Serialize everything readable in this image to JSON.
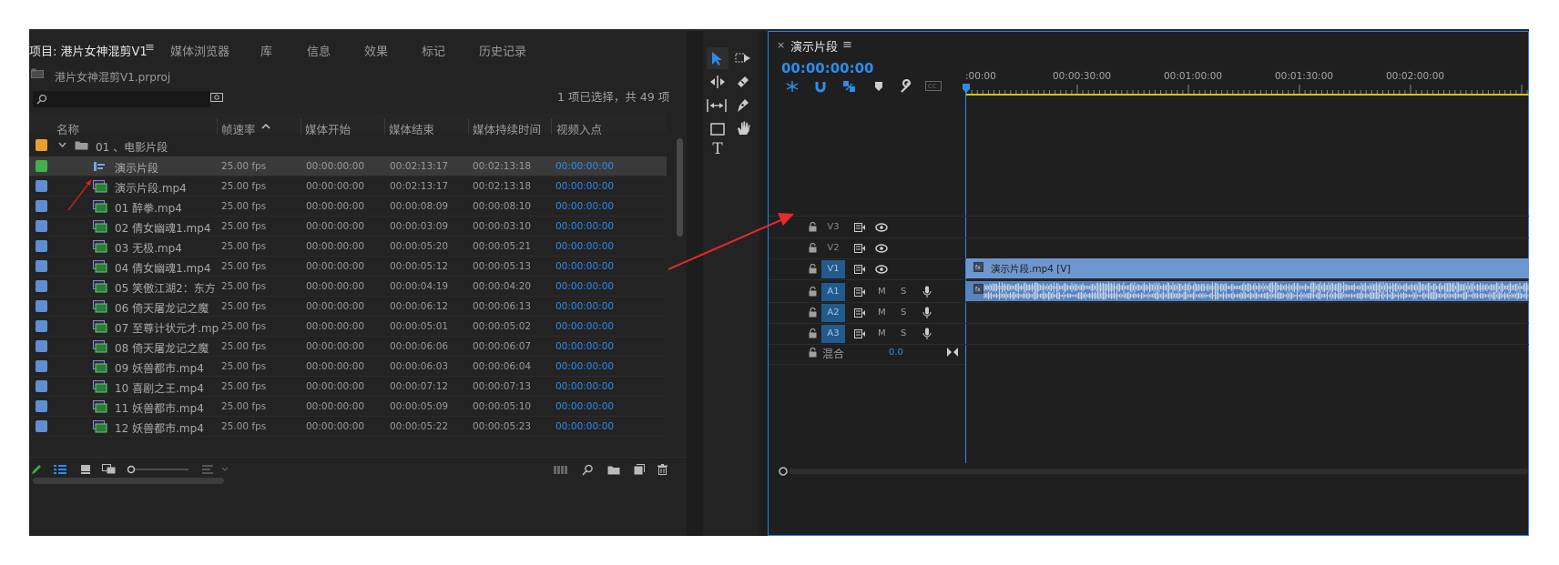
{
  "project": {
    "tabs": [
      {
        "label": "项目: 港片女神混剪V1",
        "active": true
      },
      {
        "label": "媒体浏览器"
      },
      {
        "label": "库"
      },
      {
        "label": "信息"
      },
      {
        "label": "效果"
      },
      {
        "label": "标记"
      },
      {
        "label": "历史记录"
      }
    ],
    "file": "港片女神混剪V1.prproj",
    "selection_info": "1 项已选择，共 49 项",
    "columns": [
      "名称",
      "帧速率",
      "媒体开始",
      "媒体结束",
      "媒体持续时间",
      "视频入点"
    ],
    "folder": {
      "label": "01 、电影片段",
      "color": "#e8a030"
    },
    "rows": [
      {
        "name": "演示片段",
        "fps": "25.00 fps",
        "start": "00:00:00:00",
        "end": "00:02:13:17",
        "dur": "00:02:13:18",
        "in": "00:00:00:00",
        "color": "#44b04a",
        "type": "sequence",
        "selected": true
      },
      {
        "name": "演示片段.mp4",
        "fps": "25.00 fps",
        "start": "00:00:00:00",
        "end": "00:02:13:17",
        "dur": "00:02:13:18",
        "in": "00:00:00:00",
        "color": "#5f8fd0",
        "type": "clip"
      },
      {
        "name": "01 醉拳.mp4",
        "fps": "25.00 fps",
        "start": "00:00:00:00",
        "end": "00:00:08:09",
        "dur": "00:00:08:10",
        "in": "00:00:00:00",
        "color": "#5f8fd0",
        "type": "clip"
      },
      {
        "name": "02 倩女幽魂1.mp4",
        "fps": "25.00 fps",
        "start": "00:00:00:00",
        "end": "00:00:03:09",
        "dur": "00:00:03:10",
        "in": "00:00:00:00",
        "color": "#5f8fd0",
        "type": "clip"
      },
      {
        "name": "03 无极.mp4",
        "fps": "25.00 fps",
        "start": "00:00:00:00",
        "end": "00:00:05:20",
        "dur": "00:00:05:21",
        "in": "00:00:00:00",
        "color": "#5f8fd0",
        "type": "clip"
      },
      {
        "name": "04 倩女幽魂1.mp4",
        "fps": "25.00 fps",
        "start": "00:00:00:00",
        "end": "00:00:05:12",
        "dur": "00:00:05:13",
        "in": "00:00:00:00",
        "color": "#5f8fd0",
        "type": "clip"
      },
      {
        "name": "05 笑傲江湖2：东方",
        "fps": "25.00 fps",
        "start": "00:00:00:00",
        "end": "00:00:04:19",
        "dur": "00:00:04:20",
        "in": "00:00:00:00",
        "color": "#5f8fd0",
        "type": "clip"
      },
      {
        "name": "06 倚天屠龙记之魔",
        "fps": "25.00 fps",
        "start": "00:00:00:00",
        "end": "00:00:06:12",
        "dur": "00:00:06:13",
        "in": "00:00:00:00",
        "color": "#5f8fd0",
        "type": "clip"
      },
      {
        "name": "07 至尊计状元才.mp",
        "fps": "25.00 fps",
        "start": "00:00:00:00",
        "end": "00:00:05:01",
        "dur": "00:00:05:02",
        "in": "00:00:00:00",
        "color": "#5f8fd0",
        "type": "clip"
      },
      {
        "name": "08 倚天屠龙记之魔",
        "fps": "25.00 fps",
        "start": "00:00:00:00",
        "end": "00:00:06:06",
        "dur": "00:00:06:07",
        "in": "00:00:00:00",
        "color": "#5f8fd0",
        "type": "clip"
      },
      {
        "name": "09 妖兽都市.mp4",
        "fps": "25.00 fps",
        "start": "00:00:00:00",
        "end": "00:00:06:03",
        "dur": "00:00:06:04",
        "in": "00:00:00:00",
        "color": "#5f8fd0",
        "type": "clip"
      },
      {
        "name": "10 喜剧之王.mp4",
        "fps": "25.00 fps",
        "start": "00:00:00:00",
        "end": "00:00:07:12",
        "dur": "00:00:07:13",
        "in": "00:00:00:00",
        "color": "#5f8fd0",
        "type": "clip"
      },
      {
        "name": "11 妖兽都市.mp4",
        "fps": "25.00 fps",
        "start": "00:00:00:00",
        "end": "00:00:05:09",
        "dur": "00:00:05:10",
        "in": "00:00:00:00",
        "color": "#5f8fd0",
        "type": "clip"
      },
      {
        "name": "12 妖兽都市.mp4",
        "fps": "25.00 fps",
        "start": "00:00:00:00",
        "end": "00:00:05:22",
        "dur": "00:00:05:23",
        "in": "00:00:00:00",
        "color": "#5f8fd0",
        "type": "clip"
      }
    ]
  },
  "sequence": {
    "tab": "演示片段",
    "timecode": "00:00:00:00",
    "ruler": [
      ":00:00",
      "00:00:30:00",
      "00:01:00:00",
      "00:01:30:00",
      "00:02:00:00"
    ],
    "video_tracks": [
      "V3",
      "V2",
      "V1"
    ],
    "audio_tracks": [
      "A1",
      "A2",
      "A3"
    ],
    "mix_label": "混合",
    "mix_value": "0.0",
    "mute": "M",
    "solo": "S",
    "clip_label": "演示片段.mp4 [V]",
    "accent": "#2d8ceb",
    "clip_color": "#6f97cf"
  }
}
